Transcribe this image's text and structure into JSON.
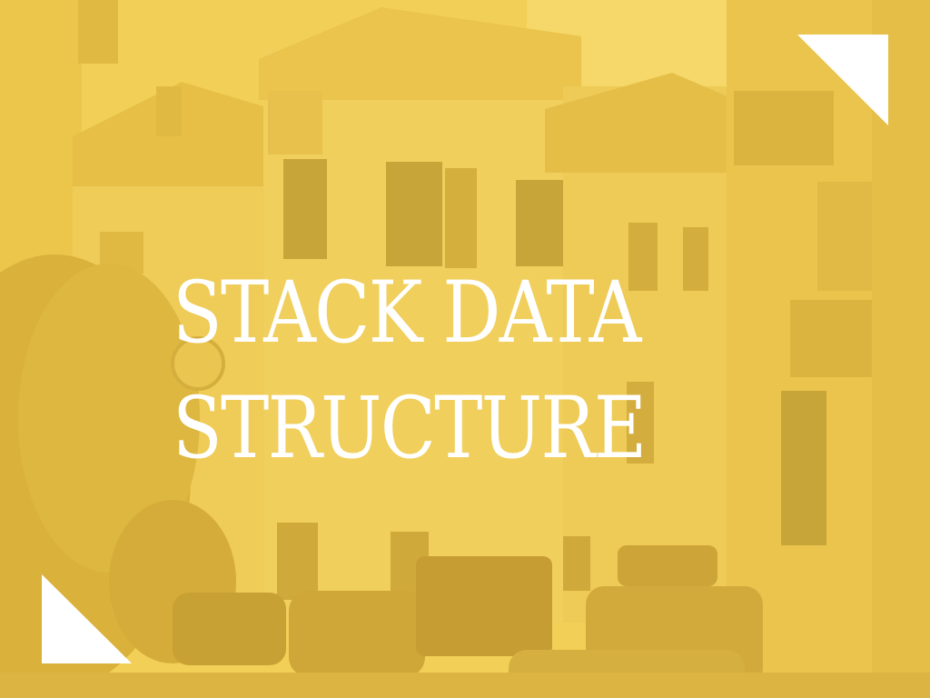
{
  "slide": {
    "title_line_1": "STACK DATA",
    "title_line_2": "STRUCTURE"
  },
  "colors": {
    "background_tint": "#f0cf58",
    "text": "#ffffff",
    "corner_marks": "#ffffff"
  },
  "icons": {
    "top_right": "corner-triangle-icon",
    "bottom_left": "corner-triangle-icon"
  }
}
